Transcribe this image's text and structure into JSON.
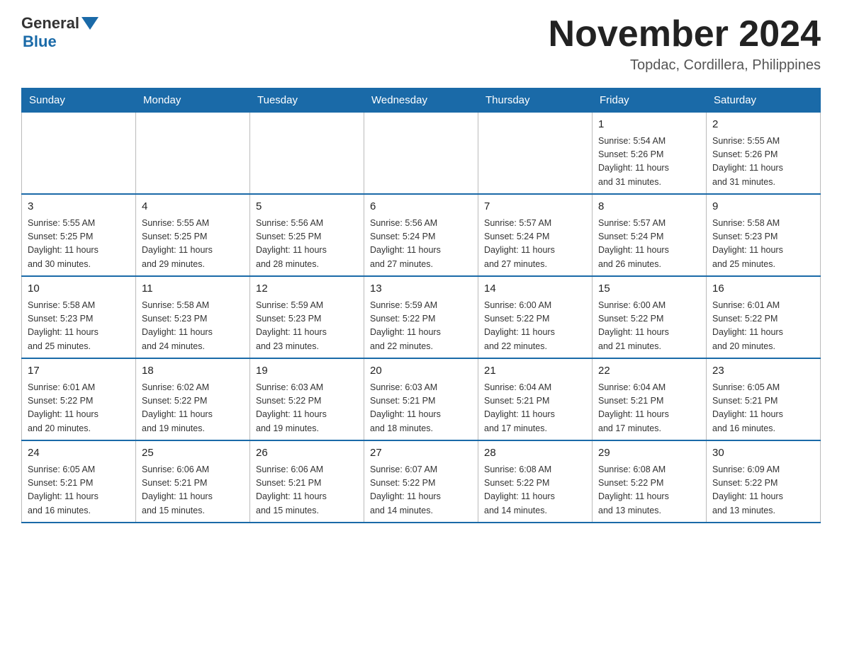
{
  "logo": {
    "general": "General",
    "blue": "Blue"
  },
  "title": "November 2024",
  "location": "Topdac, Cordillera, Philippines",
  "weekdays": [
    "Sunday",
    "Monday",
    "Tuesday",
    "Wednesday",
    "Thursday",
    "Friday",
    "Saturday"
  ],
  "weeks": [
    [
      {
        "day": "",
        "info": ""
      },
      {
        "day": "",
        "info": ""
      },
      {
        "day": "",
        "info": ""
      },
      {
        "day": "",
        "info": ""
      },
      {
        "day": "",
        "info": ""
      },
      {
        "day": "1",
        "info": "Sunrise: 5:54 AM\nSunset: 5:26 PM\nDaylight: 11 hours\nand 31 minutes."
      },
      {
        "day": "2",
        "info": "Sunrise: 5:55 AM\nSunset: 5:26 PM\nDaylight: 11 hours\nand 31 minutes."
      }
    ],
    [
      {
        "day": "3",
        "info": "Sunrise: 5:55 AM\nSunset: 5:25 PM\nDaylight: 11 hours\nand 30 minutes."
      },
      {
        "day": "4",
        "info": "Sunrise: 5:55 AM\nSunset: 5:25 PM\nDaylight: 11 hours\nand 29 minutes."
      },
      {
        "day": "5",
        "info": "Sunrise: 5:56 AM\nSunset: 5:25 PM\nDaylight: 11 hours\nand 28 minutes."
      },
      {
        "day": "6",
        "info": "Sunrise: 5:56 AM\nSunset: 5:24 PM\nDaylight: 11 hours\nand 27 minutes."
      },
      {
        "day": "7",
        "info": "Sunrise: 5:57 AM\nSunset: 5:24 PM\nDaylight: 11 hours\nand 27 minutes."
      },
      {
        "day": "8",
        "info": "Sunrise: 5:57 AM\nSunset: 5:24 PM\nDaylight: 11 hours\nand 26 minutes."
      },
      {
        "day": "9",
        "info": "Sunrise: 5:58 AM\nSunset: 5:23 PM\nDaylight: 11 hours\nand 25 minutes."
      }
    ],
    [
      {
        "day": "10",
        "info": "Sunrise: 5:58 AM\nSunset: 5:23 PM\nDaylight: 11 hours\nand 25 minutes."
      },
      {
        "day": "11",
        "info": "Sunrise: 5:58 AM\nSunset: 5:23 PM\nDaylight: 11 hours\nand 24 minutes."
      },
      {
        "day": "12",
        "info": "Sunrise: 5:59 AM\nSunset: 5:23 PM\nDaylight: 11 hours\nand 23 minutes."
      },
      {
        "day": "13",
        "info": "Sunrise: 5:59 AM\nSunset: 5:22 PM\nDaylight: 11 hours\nand 22 minutes."
      },
      {
        "day": "14",
        "info": "Sunrise: 6:00 AM\nSunset: 5:22 PM\nDaylight: 11 hours\nand 22 minutes."
      },
      {
        "day": "15",
        "info": "Sunrise: 6:00 AM\nSunset: 5:22 PM\nDaylight: 11 hours\nand 21 minutes."
      },
      {
        "day": "16",
        "info": "Sunrise: 6:01 AM\nSunset: 5:22 PM\nDaylight: 11 hours\nand 20 minutes."
      }
    ],
    [
      {
        "day": "17",
        "info": "Sunrise: 6:01 AM\nSunset: 5:22 PM\nDaylight: 11 hours\nand 20 minutes."
      },
      {
        "day": "18",
        "info": "Sunrise: 6:02 AM\nSunset: 5:22 PM\nDaylight: 11 hours\nand 19 minutes."
      },
      {
        "day": "19",
        "info": "Sunrise: 6:03 AM\nSunset: 5:22 PM\nDaylight: 11 hours\nand 19 minutes."
      },
      {
        "day": "20",
        "info": "Sunrise: 6:03 AM\nSunset: 5:21 PM\nDaylight: 11 hours\nand 18 minutes."
      },
      {
        "day": "21",
        "info": "Sunrise: 6:04 AM\nSunset: 5:21 PM\nDaylight: 11 hours\nand 17 minutes."
      },
      {
        "day": "22",
        "info": "Sunrise: 6:04 AM\nSunset: 5:21 PM\nDaylight: 11 hours\nand 17 minutes."
      },
      {
        "day": "23",
        "info": "Sunrise: 6:05 AM\nSunset: 5:21 PM\nDaylight: 11 hours\nand 16 minutes."
      }
    ],
    [
      {
        "day": "24",
        "info": "Sunrise: 6:05 AM\nSunset: 5:21 PM\nDaylight: 11 hours\nand 16 minutes."
      },
      {
        "day": "25",
        "info": "Sunrise: 6:06 AM\nSunset: 5:21 PM\nDaylight: 11 hours\nand 15 minutes."
      },
      {
        "day": "26",
        "info": "Sunrise: 6:06 AM\nSunset: 5:21 PM\nDaylight: 11 hours\nand 15 minutes."
      },
      {
        "day": "27",
        "info": "Sunrise: 6:07 AM\nSunset: 5:22 PM\nDaylight: 11 hours\nand 14 minutes."
      },
      {
        "day": "28",
        "info": "Sunrise: 6:08 AM\nSunset: 5:22 PM\nDaylight: 11 hours\nand 14 minutes."
      },
      {
        "day": "29",
        "info": "Sunrise: 6:08 AM\nSunset: 5:22 PM\nDaylight: 11 hours\nand 13 minutes."
      },
      {
        "day": "30",
        "info": "Sunrise: 6:09 AM\nSunset: 5:22 PM\nDaylight: 11 hours\nand 13 minutes."
      }
    ]
  ]
}
